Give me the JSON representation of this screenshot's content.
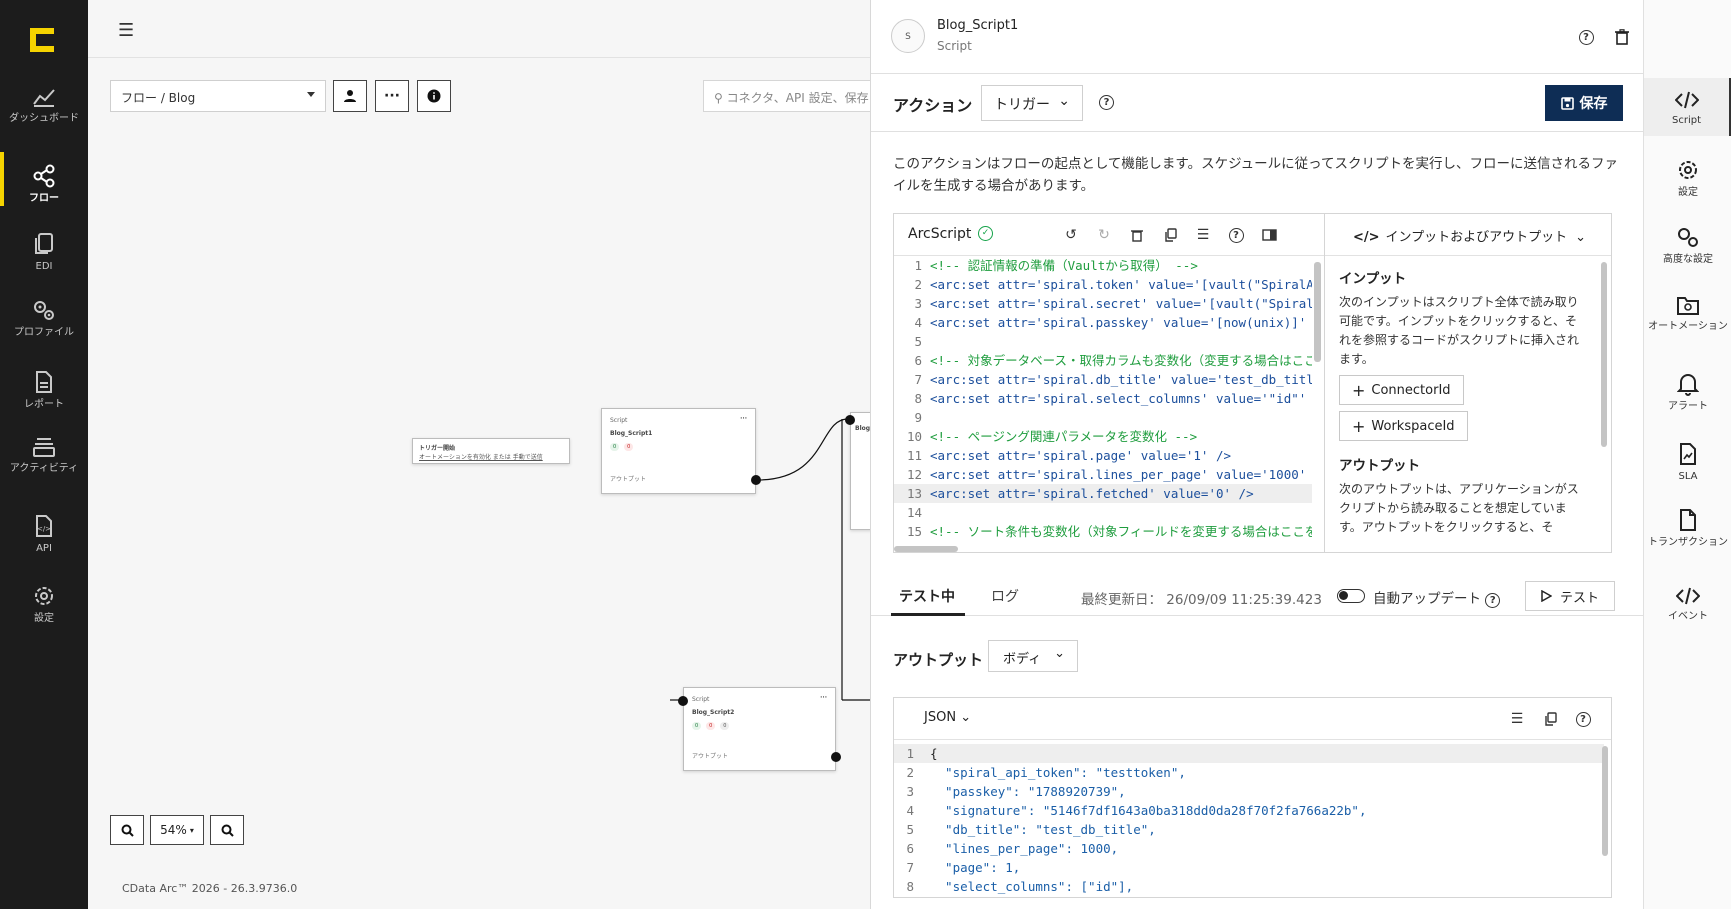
{
  "nav": {
    "items": [
      {
        "label": "ダッシュボード"
      },
      {
        "label": "フロー"
      },
      {
        "label": "EDI"
      },
      {
        "label": "プロファイル"
      },
      {
        "label": "レポート"
      },
      {
        "label": "アクティビティ"
      },
      {
        "label": "API"
      },
      {
        "label": "設定"
      }
    ]
  },
  "canvas": {
    "breadcrumb": "フロー  /   Blog",
    "search_placeholder": "コネクタ、API 設定、保存",
    "trigger_node": {
      "title": "トリガー開始",
      "sub": "オートメーションを有効化 または 手動で送信"
    },
    "script1_node": {
      "type": "Script",
      "name": "Blog_Script1",
      "out": "アウトプット"
    },
    "script2_node": {
      "type": "Script",
      "name": "Blog_Script2",
      "out": "アウトプット"
    },
    "partial_node_label": "Blog",
    "zoom": "54%",
    "footer": "CData Arc™ 2026 - 26.3.9736.0"
  },
  "panel": {
    "title": "Blog_Script1",
    "subtitle": "Script",
    "avatar_text": "S",
    "action_label": "アクション",
    "action_value": "トリガー",
    "save_label": "保存",
    "description": "このアクションはフローの起点として機能します。スケジュールに従ってスクリプトを実行し、フローに送信されるファイルを生成する場合があります。",
    "editor_title": "ArcScript",
    "io_header": "インプットおよびアウトプット",
    "input_title": "インプット",
    "input_desc": "次のインプットはスクリプト全体で読み取り可能です。インプットをクリックすると、それを参照するコードがスクリプトに挿入されます。",
    "input_buttons": [
      "ConnectorId",
      "WorkspaceId"
    ],
    "output_title": "アウトプット",
    "output_desc": "次のアウトプットは、アプリケーションがスクリプトから読み取ることを想定しています。アウトプットをクリックすると、そ",
    "tab_testing": "テスト中",
    "tab_log": "ログ",
    "last_updated": "最終更新日：  26/09/09 11:25:39.423",
    "auto_update_label": "自動アップデート",
    "test_label": "テスト",
    "output_label": "アウトプット",
    "output_dd": "ボディ",
    "json_dd": "JSON"
  },
  "code_lines": [
    {
      "n": "1",
      "t": "<!-- 認証情報の準備（Vaultから取得） -->"
    },
    {
      "n": "2",
      "t": "<arc:set attr='spiral.token' value='[vault(\"SpiralA"
    },
    {
      "n": "3",
      "t": "<arc:set attr='spiral.secret' value='[vault(\"Spiral"
    },
    {
      "n": "4",
      "t": "<arc:set attr='spiral.passkey' value='[now(unix)]'"
    },
    {
      "n": "5",
      "t": ""
    },
    {
      "n": "6",
      "t": "<!-- 対象データベース・取得カラムも変数化（変更する場合はここ"
    },
    {
      "n": "7",
      "t": "<arc:set attr='spiral.db_title' value='test_db_titl"
    },
    {
      "n": "8",
      "t": "<arc:set attr='spiral.select_columns' value='\"id\"'"
    },
    {
      "n": "9",
      "t": ""
    },
    {
      "n": "10",
      "t": "<!-- ページング関連パラメータを変数化 -->"
    },
    {
      "n": "11",
      "t": "<arc:set attr='spiral.page' value='1' />"
    },
    {
      "n": "12",
      "t": "<arc:set attr='spiral.lines_per_page' value='1000'"
    },
    {
      "n": "13",
      "t": "<arc:set attr='spiral.fetched' value='0' />"
    },
    {
      "n": "14",
      "t": ""
    },
    {
      "n": "15",
      "t": "<!-- ソート条件も変数化（対象フィールドを変更する場合はここを"
    }
  ],
  "json_lines": [
    {
      "n": "1",
      "t": "{"
    },
    {
      "n": "2",
      "t": "  \"spiral_api_token\": \"testtoken\","
    },
    {
      "n": "3",
      "t": "  \"passkey\": \"1788920739\","
    },
    {
      "n": "4",
      "t": "  \"signature\": \"5146f7df1643a0ba318dd0da28f70f2fa766a22b\","
    },
    {
      "n": "5",
      "t": "  \"db_title\": \"test_db_title\","
    },
    {
      "n": "6",
      "t": "  \"lines_per_page\": 1000,"
    },
    {
      "n": "7",
      "t": "  \"page\": 1,"
    },
    {
      "n": "8",
      "t": "  \"select_columns\": [\"id\"],"
    }
  ],
  "rail": {
    "items": [
      {
        "label": "Script"
      },
      {
        "label": "設定"
      },
      {
        "label": "高度な設定"
      },
      {
        "label": "オートメーション"
      },
      {
        "label": "アラート"
      },
      {
        "label": "SLA"
      },
      {
        "label": "トランザクション"
      },
      {
        "label": "イベント"
      }
    ]
  },
  "colors": {
    "accent_yellow": "#f5d300",
    "save_blue": "#0e2d55",
    "nav_bg": "#1c1c1c"
  }
}
